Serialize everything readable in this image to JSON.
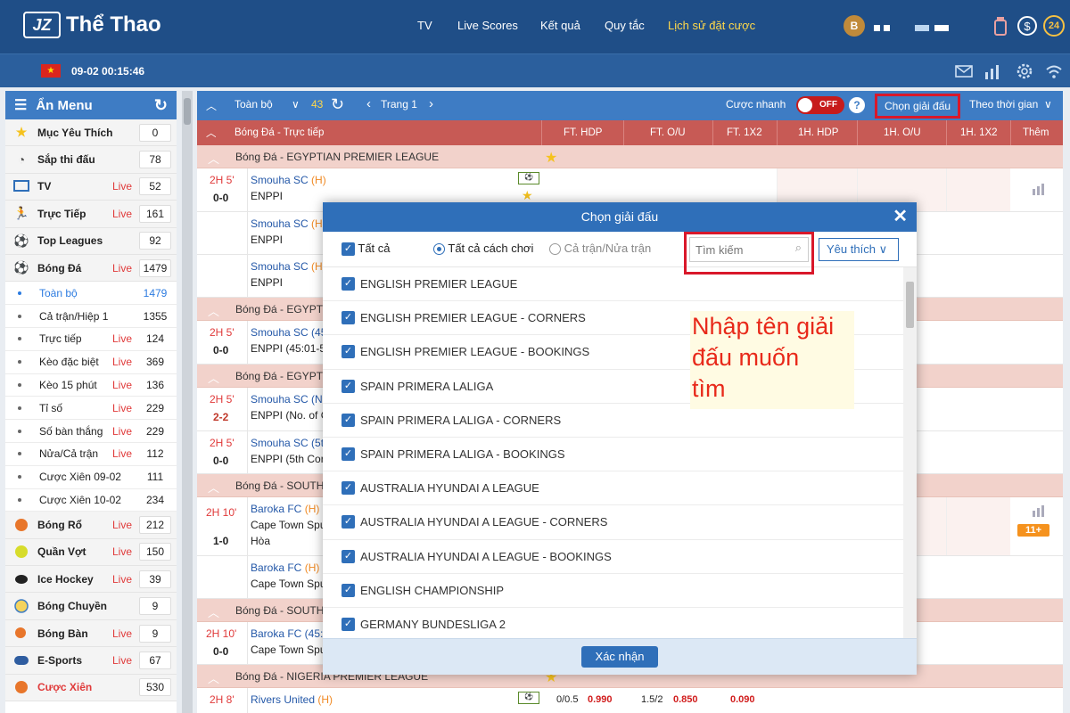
{
  "brand": {
    "logo": "JZ",
    "name": "Thể Thao"
  },
  "nav": [
    {
      "label": "TV"
    },
    {
      "label": "Live Scores"
    },
    {
      "label": "Kết quả"
    },
    {
      "label": "Quy tắc"
    },
    {
      "label": "Lịch sử đặt cược"
    }
  ],
  "user": {
    "avatar": "B",
    "badge_label": "24"
  },
  "subbar": {
    "datetime": "09-02 00:15:46"
  },
  "sidebar": {
    "title": "Ẩn Menu",
    "items": [
      {
        "label": "Mục Yêu Thích",
        "count": "0",
        "icon": "star-icon"
      },
      {
        "label": "Sắp thi đấu",
        "count": "78",
        "icon": "stopwatch-icon"
      },
      {
        "label": "TV",
        "live": "Live",
        "count": "52",
        "icon": "tv-icon"
      },
      {
        "label": "Trực Tiếp",
        "live": "Live",
        "count": "161",
        "icon": "running-icon"
      },
      {
        "label": "Top Leagues",
        "count": "92",
        "icon": "soccer-ball-icon"
      },
      {
        "label": "Bóng Đá",
        "live": "Live",
        "count": "1479",
        "icon": "soccer-ball-icon"
      }
    ],
    "subitems": [
      {
        "label": "Toàn bộ",
        "count": "1479"
      },
      {
        "label": "Cả trận/Hiệp 1",
        "count": "1355"
      },
      {
        "label": "Trực tiếp",
        "live": "Live",
        "count": "124"
      },
      {
        "label": "Kèo đặc biệt",
        "live": "Live",
        "count": "369"
      },
      {
        "label": "Kèo 15 phút",
        "live": "Live",
        "count": "136"
      },
      {
        "label": "Tỉ số",
        "live": "Live",
        "count": "229"
      },
      {
        "label": "Số bàn thắng",
        "live": "Live",
        "count": "229"
      },
      {
        "label": "Nửa/Cả trận",
        "live": "Live",
        "count": "112"
      },
      {
        "label": "Cược Xiên 09-02",
        "count": "111"
      },
      {
        "label": "Cược Xiên 10-02",
        "count": "234"
      }
    ],
    "sports": [
      {
        "label": "Bóng Rổ",
        "live": "Live",
        "count": "212",
        "icon": "basketball-icon"
      },
      {
        "label": "Quần Vợt",
        "live": "Live",
        "count": "150",
        "icon": "tennis-ball-icon"
      },
      {
        "label": "Ice Hockey",
        "live": "Live",
        "count": "39",
        "icon": "hockey-puck-icon"
      },
      {
        "label": "Bóng Chuyền",
        "count": "9",
        "icon": "volleyball-icon"
      },
      {
        "label": "Bóng Bàn",
        "live": "Live",
        "count": "9",
        "icon": "ping-pong-icon"
      },
      {
        "label": "E-Sports",
        "live": "Live",
        "count": "67",
        "icon": "gamepad-icon"
      },
      {
        "label": "Cược Xiên",
        "count": "530",
        "icon": "parlay-icon"
      }
    ]
  },
  "toolbar": {
    "all": "Toàn bộ",
    "count": "43",
    "page": "Trang 1",
    "quick_bet": "Cược nhanh",
    "toggle": "OFF",
    "help": "?",
    "choose_league": "Chọn giải đấu",
    "by_time": "Theo thời gian"
  },
  "table": {
    "section": "Bóng Đá - Trực tiếp",
    "columns": [
      "FT. HDP",
      "FT. O/U",
      "FT. 1X2",
      "1H. HDP",
      "1H. O/U",
      "1H. 1X2",
      "Thêm"
    ],
    "leagues": [
      "Bóng Đá - EGYPTIAN PREMIER LEAGUE",
      "Bóng Đá - EGYPTIA",
      "Bóng Đá - EGYPTIA",
      "Bóng Đá - SOUTH A",
      "Bóng Đá - SOUTH A",
      "Bóng Đá - NIGERIA PREMIER LEAGUE"
    ],
    "rows": [
      {
        "time": "2H 5'",
        "score": "0-0",
        "home": "Smouha SC",
        "home_tag": "(H)",
        "away": "ENPPI"
      },
      {
        "time": "",
        "score": "",
        "home": "Smouha SC",
        "home_tag": "(H)",
        "away": "ENPPI"
      },
      {
        "time": "",
        "score": "",
        "home": "Smouha SC",
        "home_tag": "(H)",
        "away": "ENPPI"
      },
      {
        "time": "2H 5'",
        "score": "0-0",
        "home": "Smouha SC (45",
        "home_tag": "",
        "away": "ENPPI (45:01-5"
      },
      {
        "time": "2H 5'",
        "score": "2-2",
        "home": "Smouha SC (No",
        "home_tag": "",
        "away": "ENPPI (No. of C"
      },
      {
        "time": "2H 5'",
        "score": "0-0",
        "home": "Smouha SC (5th",
        "home_tag": "",
        "away": "ENPPI (5th Cor"
      },
      {
        "time": "2H 10'",
        "score": "1-0",
        "home": "Baroka FC",
        "home_tag": "(H)",
        "away": "Cape Town Spu",
        "draw": "Hòa",
        "more": "11+"
      },
      {
        "time": "",
        "score": "",
        "home": "Baroka FC",
        "home_tag": "(H)",
        "away": "Cape Town Spu"
      },
      {
        "time": "2H 10'",
        "score": "0-0",
        "home": "Baroka FC (45:0",
        "home_tag": "",
        "away": "Cape Town Spu"
      },
      {
        "time": "2H 8'",
        "score": "",
        "home": "Rivers United",
        "home_tag": "(H)",
        "away": "",
        "hdp": "0/0.5",
        "hdp_odds": "0.990",
        "ou": "1.5/2",
        "ou_odds": "0.850",
        "x12": "0.090"
      }
    ]
  },
  "modal": {
    "title": "Chọn giải đấu",
    "all": "Tất cả",
    "opt_all": "Tất cả cách chơi",
    "opt_half": "Cả trận/Nửa trận",
    "search_placeholder": "Tìm kiếm",
    "favorite": "Yêu thích",
    "leagues": [
      "ENGLISH PREMIER LEAGUE",
      "ENGLISH PREMIER LEAGUE - CORNERS",
      "ENGLISH PREMIER LEAGUE - BOOKINGS",
      "SPAIN PRIMERA LALIGA",
      "SPAIN PRIMERA LALIGA - CORNERS",
      "SPAIN PRIMERA LALIGA - BOOKINGS",
      "AUSTRALIA HYUNDAI A LEAGUE",
      "AUSTRALIA HYUNDAI A LEAGUE - CORNERS",
      "AUSTRALIA HYUNDAI A LEAGUE - BOOKINGS",
      "ENGLISH CHAMPIONSHIP",
      "GERMANY BUNDESLIGA 2"
    ],
    "confirm": "Xác nhận"
  },
  "annotation": {
    "line1": "Nhập tên giải",
    "line2": "đấu muốn",
    "line3": "tìm"
  },
  "colors": {
    "header": "#1f4e87",
    "accent": "#3e7cc4",
    "table_head": "#c75a55",
    "highlight": "#d9182a",
    "live": "#e03a3a"
  }
}
